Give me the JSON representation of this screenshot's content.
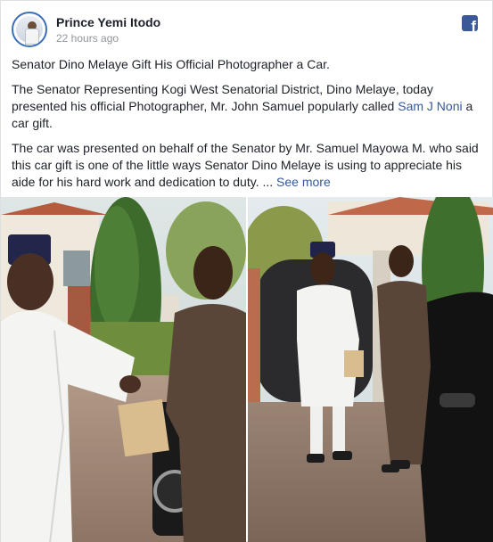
{
  "post": {
    "author": "Prince Yemi Itodo",
    "timestamp": "22 hours ago",
    "headline": "Senator Dino Melaye Gift His Official Photographer a Car.",
    "para2_before_link": "The Senator Representing Kogi West Senatorial District, Dino Melaye, today presented his official Photographer, Mr. John Samuel popularly called ",
    "para2_link": "Sam J Noni",
    "para2_after_link": " a car gift.",
    "para3": "The car was presented on behalf of the Senator by Mr. Samuel Mayowa M. who said this car gift is one of the little ways Senator Dino Melaye is using to appreciate his aide for his hard work and dedication to duty. ... ",
    "see_more": "See more"
  },
  "icons": {
    "network": "facebook-icon",
    "network_glyph": "f",
    "avatar": "profile-avatar"
  },
  "colors": {
    "link": "#365899",
    "facebook_blue": "#3b5998",
    "text": "#1d2129",
    "muted": "#90949c"
  }
}
